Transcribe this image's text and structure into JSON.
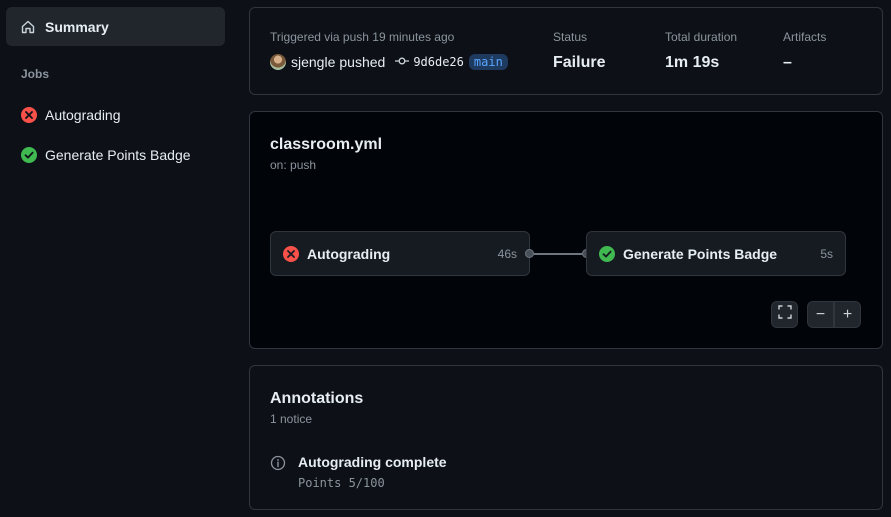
{
  "sidebar": {
    "summary_label": "Summary",
    "jobs_heading": "Jobs",
    "jobs": [
      {
        "label": "Autograding",
        "status": "failure"
      },
      {
        "label": "Generate Points Badge",
        "status": "success"
      }
    ]
  },
  "run_summary": {
    "trigger_text": "Triggered via push 19 minutes ago",
    "actor": "sjengle",
    "action": "pushed",
    "commit_sha": "9d6de26",
    "branch": "main",
    "status_label": "Status",
    "status_value": "Failure",
    "duration_label": "Total duration",
    "duration_value": "1m 19s",
    "artifacts_label": "Artifacts",
    "artifacts_value": "–"
  },
  "workflow": {
    "file": "classroom.yml",
    "on": "on: push",
    "jobs": [
      {
        "label": "Autograding",
        "duration": "46s",
        "status": "failure"
      },
      {
        "label": "Generate Points Badge",
        "duration": "5s",
        "status": "success"
      }
    ],
    "controls": {
      "zoom_out": "−",
      "zoom_in": "+"
    }
  },
  "annotations": {
    "title": "Annotations",
    "count": "1 notice",
    "items": [
      {
        "title": "Autograding complete",
        "message": "Points 5/100"
      }
    ]
  },
  "colors": {
    "failure": "#f85149",
    "success": "#3fb950",
    "accent": "#58a6ff"
  }
}
